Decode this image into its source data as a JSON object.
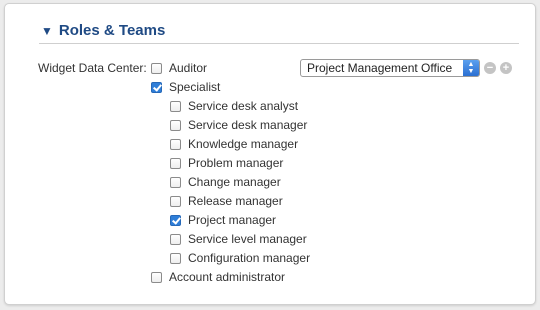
{
  "section": {
    "title": "Roles & Teams"
  },
  "field": {
    "label": "Widget Data Center:"
  },
  "roles": {
    "auditor": "Auditor",
    "specialist": "Specialist",
    "account_admin": "Account administrator"
  },
  "specialist_roles": [
    {
      "label": "Service desk analyst",
      "checked": false
    },
    {
      "label": "Service desk manager",
      "checked": false
    },
    {
      "label": "Knowledge manager",
      "checked": false
    },
    {
      "label": "Problem manager",
      "checked": false
    },
    {
      "label": "Change manager",
      "checked": false
    },
    {
      "label": "Release manager",
      "checked": false
    },
    {
      "label": "Project manager",
      "checked": true
    },
    {
      "label": "Service level manager",
      "checked": false
    },
    {
      "label": "Configuration manager",
      "checked": false
    }
  ],
  "team_select": {
    "value": "Project Management Office"
  },
  "icons": {
    "remove": "minus-circle-icon",
    "add": "plus-circle-icon"
  },
  "colors": {
    "accent": "#1f4a84",
    "check": "#2f7ed8"
  }
}
